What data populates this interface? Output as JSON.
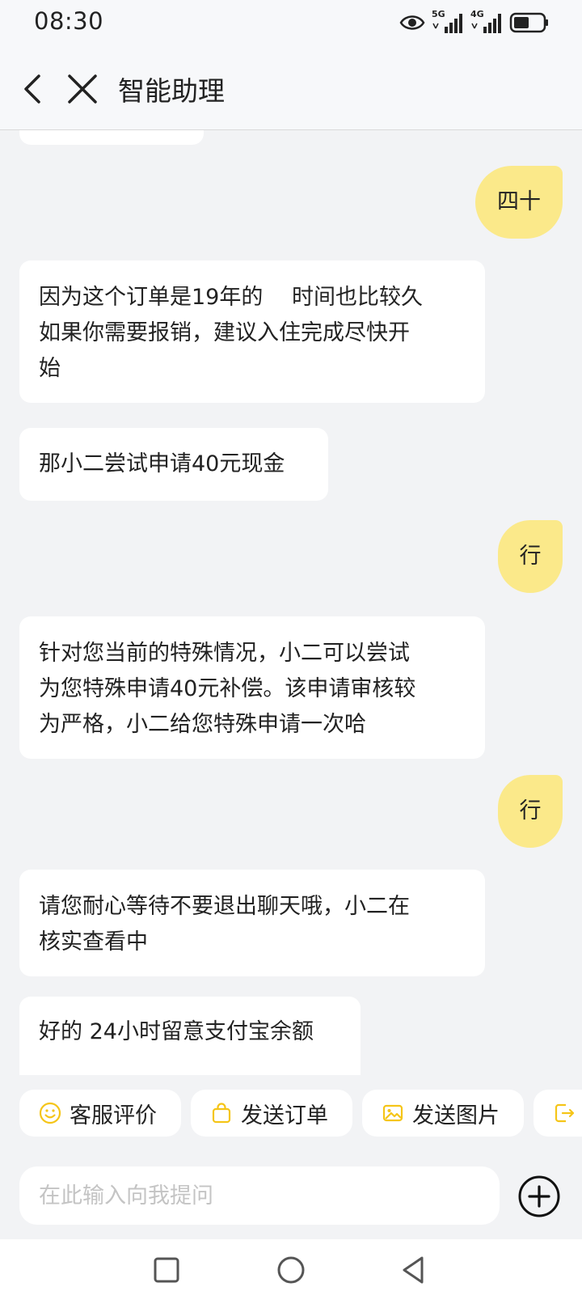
{
  "status_bar": {
    "time": "08:30",
    "icons": [
      "eye-icon",
      "signal-5g-icon",
      "signal-4g-icon",
      "battery-icon"
    ],
    "network_labels": [
      "5G",
      "4G"
    ]
  },
  "header": {
    "title": "智能助理",
    "back_icon": "chevron-left-icon",
    "close_icon": "close-icon"
  },
  "messages": [
    {
      "side": "left",
      "text": ""
    },
    {
      "side": "right",
      "text": "四十"
    },
    {
      "side": "left",
      "lines": [
        "因为这个订单是19年的　 时间也比较久",
        "如果你需要报销，建议入住完成尽快开",
        "始"
      ]
    },
    {
      "side": "left",
      "text": "那小二尝试申请40元现金"
    },
    {
      "side": "right",
      "text": "行"
    },
    {
      "side": "left",
      "lines": [
        "针对您当前的特殊情况，小二可以尝试",
        "为您特殊申请40元补偿。该申请审核较",
        "为严格，小二给您特殊申请一次哈"
      ]
    },
    {
      "side": "right",
      "text": "行"
    },
    {
      "side": "left",
      "lines": [
        "请您耐心等待不要退出聊天哦，小二在",
        "核实查看中"
      ]
    },
    {
      "side": "left",
      "text": "好的 24小时留意支付宝余额"
    }
  ],
  "quick_actions": [
    {
      "label": "客服评价",
      "icon": "smiley-icon"
    },
    {
      "label": "发送订单",
      "icon": "shopping-bag-icon"
    },
    {
      "label": "发送图片",
      "icon": "image-icon"
    },
    {
      "label": "",
      "icon": "exit-icon"
    }
  ],
  "input": {
    "placeholder": "在此输入向我提问"
  },
  "colors": {
    "accent": "#f5c518",
    "user_bubble": "#fbe98a",
    "agent_bubble": "#ffffff",
    "background": "#f2f3f5"
  }
}
